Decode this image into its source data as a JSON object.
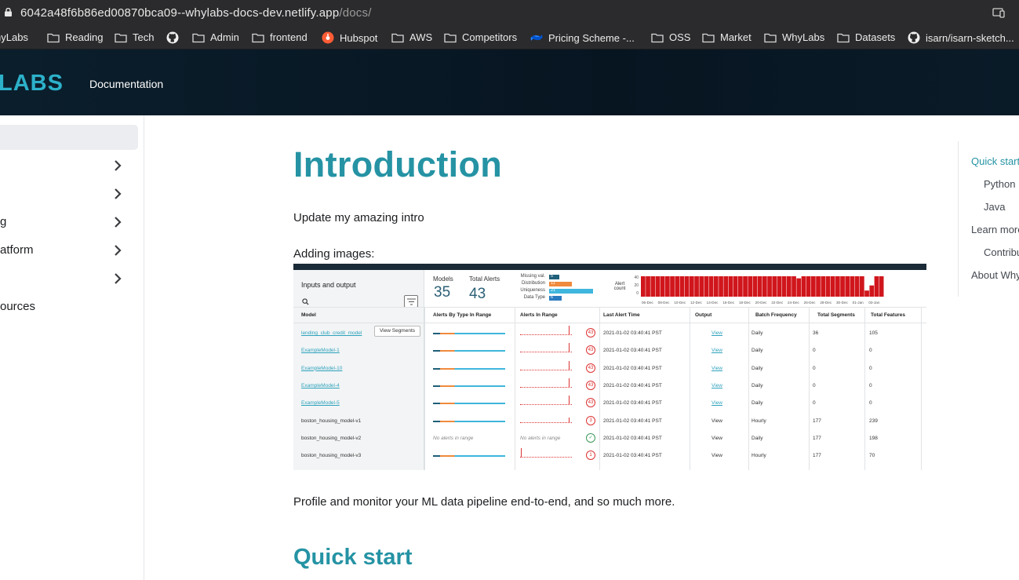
{
  "browser": {
    "url_host": "6042a48f6b86ed00870bca09--whylabs-docs-dev.netlify.app",
    "url_path": "/docs/",
    "bookmarks": [
      {
        "label": "hyLabs",
        "icon": "folder-icon"
      },
      {
        "label": "Reading",
        "icon": "folder-icon"
      },
      {
        "label": "Tech",
        "icon": "folder-icon"
      },
      {
        "label": "",
        "icon": "github-icon"
      },
      {
        "label": "Admin",
        "icon": "folder-icon"
      },
      {
        "label": "frontend",
        "icon": "folder-icon"
      },
      {
        "label": "Hubspot",
        "icon": "hubspot-icon"
      },
      {
        "label": "AWS",
        "icon": "folder-icon"
      },
      {
        "label": "Competitors",
        "icon": "folder-icon"
      },
      {
        "label": "Pricing Scheme -...",
        "icon": "confluence-icon"
      },
      {
        "label": "OSS",
        "icon": "folder-icon"
      },
      {
        "label": "Market",
        "icon": "folder-icon"
      },
      {
        "label": "WhyLabs",
        "icon": "folder-icon"
      },
      {
        "label": "Datasets",
        "icon": "folder-icon"
      },
      {
        "label": "isarn/isarn-sketch...",
        "icon": "github-icon"
      }
    ]
  },
  "header": {
    "logo": "LABS",
    "nav_documentation": "Documentation"
  },
  "sidebar": {
    "items": [
      {
        "label": "",
        "expandable": true
      },
      {
        "label": "",
        "expandable": true
      },
      {
        "label": "g",
        "expandable": true
      },
      {
        "label": "atform",
        "expandable": true
      },
      {
        "label": "",
        "expandable": true
      },
      {
        "label": "ources",
        "expandable": false
      }
    ]
  },
  "main": {
    "title": "Introduction",
    "intro": "Update my amazing intro",
    "images_label": "Adding images:",
    "profile_text": "Profile and monitor your ML data pipeline end-to-end, and so much more.",
    "quick_start_heading": "Quick start"
  },
  "toc": {
    "items": [
      {
        "label": "Quick start",
        "active": true,
        "indent": false
      },
      {
        "label": "Python",
        "active": false,
        "indent": true
      },
      {
        "label": "Java",
        "active": false,
        "indent": true
      },
      {
        "label": "Learn more",
        "active": false,
        "indent": false
      },
      {
        "label": "Contributing",
        "active": false,
        "indent": true
      },
      {
        "label": "About WhyLabs",
        "active": false,
        "indent": false
      }
    ]
  },
  "embedded_screenshot": {
    "panel_title": "Inputs and output",
    "models_label": "Models",
    "models_value": "35",
    "alerts_label": "Total Alerts",
    "alerts_value": "43",
    "alert_types": [
      {
        "label": "Missing val.",
        "value": "5",
        "color": "#1f5f7a"
      },
      {
        "label": "Distribution",
        "value": "11",
        "color": "#f08a3c"
      },
      {
        "label": "Uniqueness",
        "value": "21",
        "color": "#3fb6dd"
      },
      {
        "label": "Data Type",
        "value": "6",
        "color": "#2a7bbf"
      }
    ],
    "alert_count_label": "Alert count",
    "alert_count_ticks": [
      "40",
      "20",
      "0"
    ],
    "date_ticks": [
      "06-Dec",
      "08-Dec",
      "10-Dec",
      "12-Dec",
      "14-Dec",
      "16-Dec",
      "18-Dec",
      "20-Dec",
      "22-Dec",
      "24-Dec",
      "26-Dec",
      "28-Dec",
      "30-Dec",
      "01-Jan",
      "03-Jan"
    ],
    "alert_bar_levels": [
      1,
      1,
      1,
      1,
      1,
      1,
      1,
      1,
      1,
      1,
      1,
      1,
      1,
      1,
      1,
      1,
      1,
      1,
      1,
      1,
      1,
      1,
      1,
      1,
      1,
      1,
      1,
      1,
      1,
      1,
      1,
      1,
      0.9,
      1,
      1,
      1,
      1,
      1,
      1,
      1,
      1,
      1,
      1,
      1,
      1,
      1,
      0.3,
      0.55,
      1,
      1
    ],
    "columns": [
      "Model",
      "Alerts By Type In Range",
      "Alerts In Range",
      "Last Alert Time",
      "Output",
      "Batch Frequency",
      "Total Segments",
      "Total Features"
    ],
    "view_segments": "View Segments",
    "rows": [
      {
        "model": "lending_club_credit_model",
        "link": true,
        "alerts": "43",
        "time": "2021-01-02 03:40:41 PST",
        "output": "View",
        "output_link": true,
        "freq": "Daily",
        "segments": "36",
        "features": "105",
        "no_alerts": false
      },
      {
        "model": "ExampleModel-1",
        "link": true,
        "alerts": "43",
        "time": "2021-01-02 03:40:41 PST",
        "output": "View",
        "output_link": true,
        "freq": "Daily",
        "segments": "0",
        "features": "0",
        "no_alerts": false
      },
      {
        "model": "ExampleModel-10",
        "link": true,
        "alerts": "43",
        "time": "2021-01-02 03:40:41 PST",
        "output": "View",
        "output_link": true,
        "freq": "Daily",
        "segments": "0",
        "features": "0",
        "no_alerts": false
      },
      {
        "model": "ExampleModel-4",
        "link": true,
        "alerts": "43",
        "time": "2021-01-02 03:40:41 PST",
        "output": "View",
        "output_link": true,
        "freq": "Daily",
        "segments": "0",
        "features": "0",
        "no_alerts": false
      },
      {
        "model": "ExampleModel-5",
        "link": true,
        "alerts": "43",
        "time": "2021-01-02 03:40:41 PST",
        "output": "View",
        "output_link": true,
        "freq": "Daily",
        "segments": "0",
        "features": "0",
        "no_alerts": false
      },
      {
        "model": "boston_housing_model-v1",
        "link": false,
        "alerts": "3",
        "time": "2021-01-02 03:40:41 PST",
        "output": "View",
        "output_link": false,
        "freq": "Hourly",
        "segments": "177",
        "features": "239",
        "no_alerts": false
      },
      {
        "model": "boston_housing_model-v2",
        "link": false,
        "alerts": "",
        "time": "2021-01-02 03:40:41 PST",
        "output": "View",
        "output_link": false,
        "freq": "Daily",
        "segments": "177",
        "features": "198",
        "no_alerts": true
      },
      {
        "model": "boston_housing_model-v3",
        "link": false,
        "alerts": "1",
        "time": "2021-01-02 03:40:41 PST",
        "output": "View",
        "output_link": false,
        "freq": "Hourly",
        "segments": "177",
        "features": "70",
        "no_alerts": false
      }
    ],
    "no_alerts_text": "No alerts in range",
    "colors": {
      "accent": "#2593a4",
      "alert_red": "#d32f2f",
      "bar_red": "#d0161c"
    }
  }
}
